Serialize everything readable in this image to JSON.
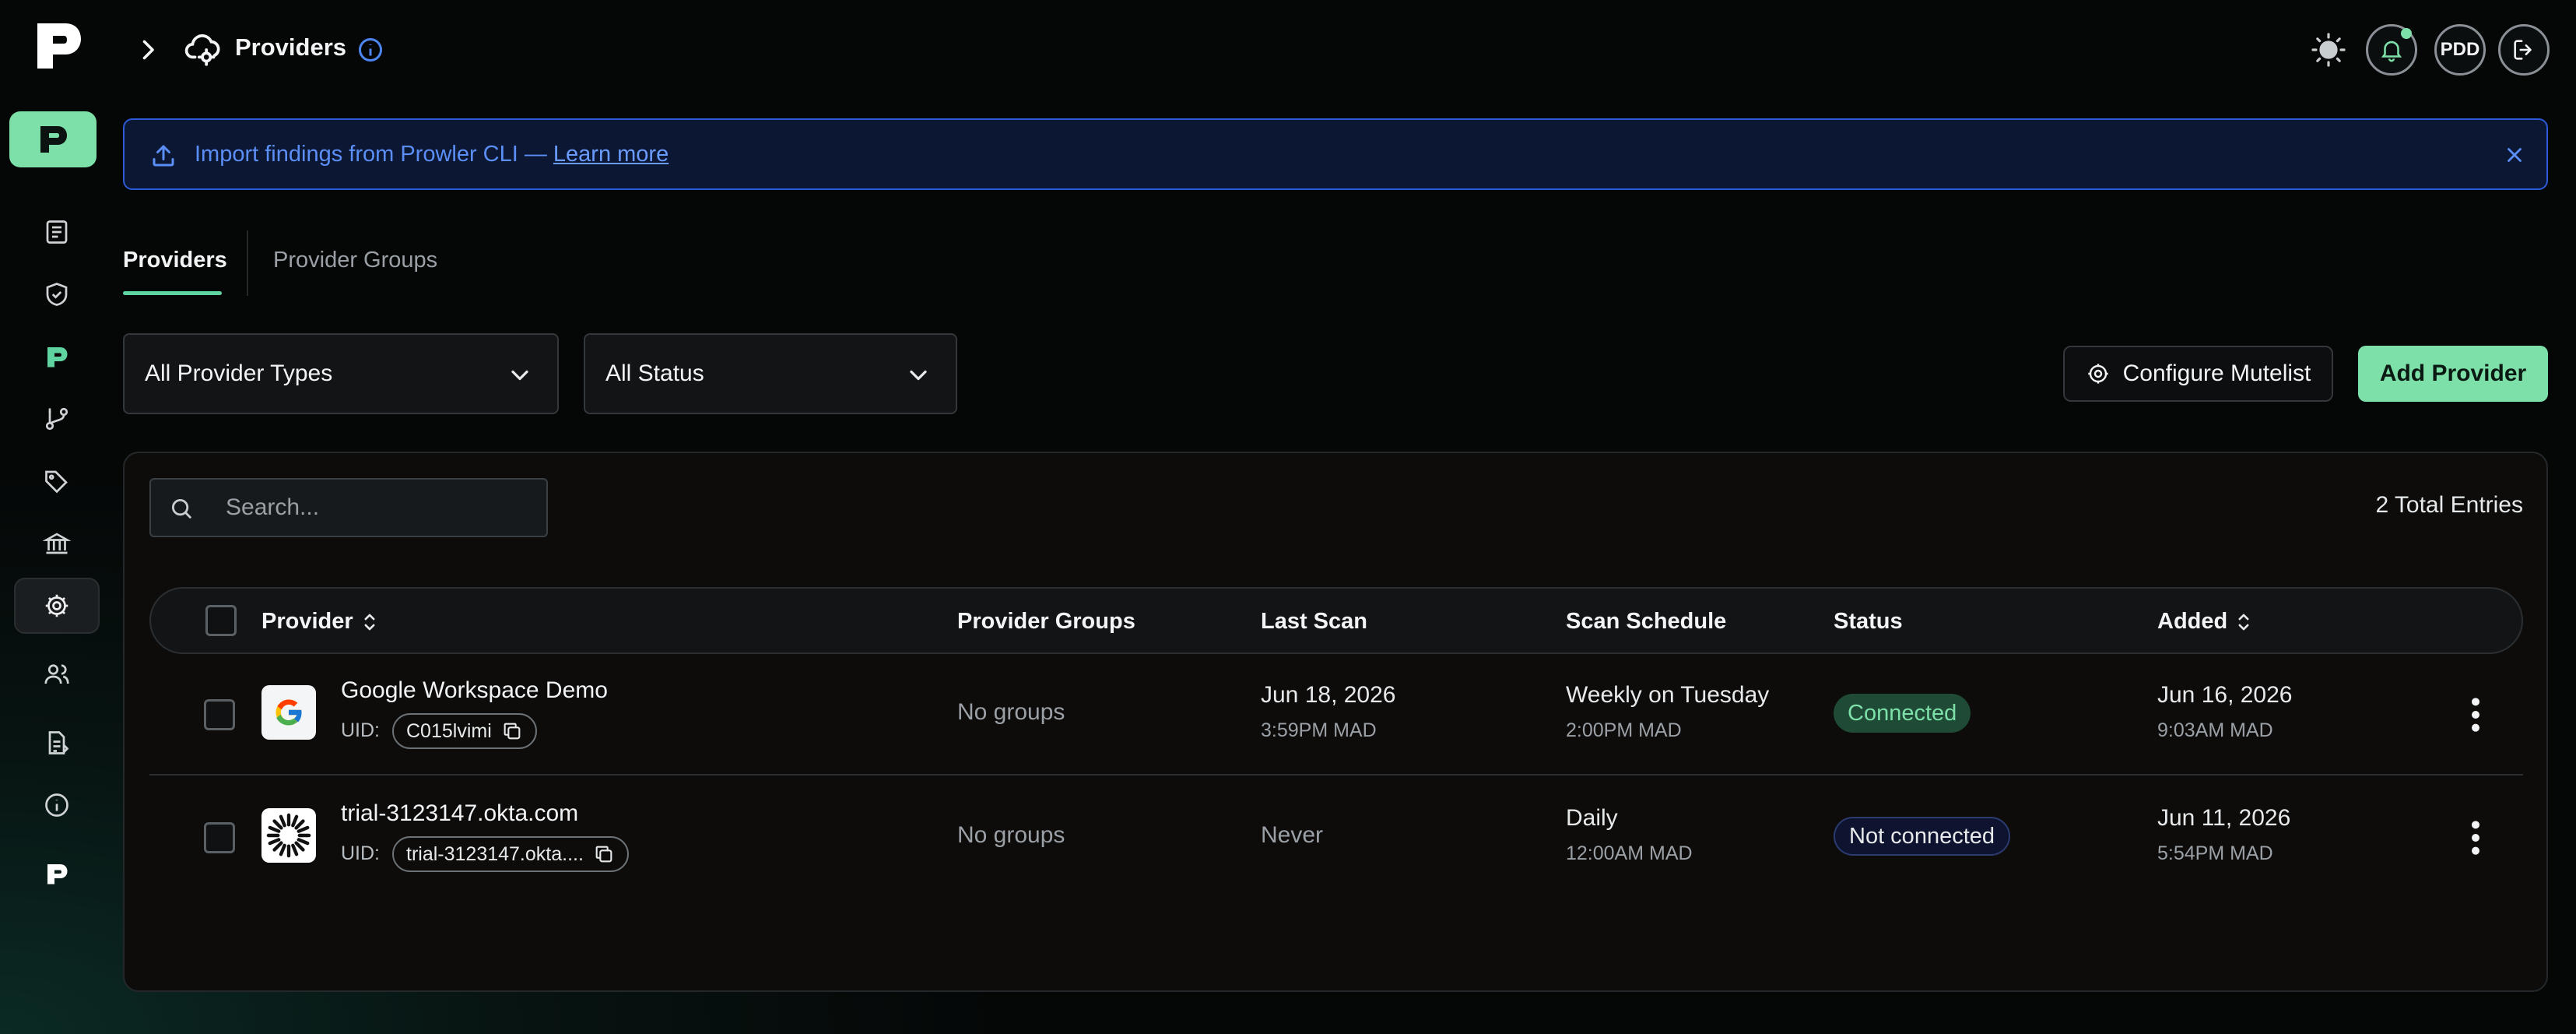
{
  "header": {
    "title": "Providers"
  },
  "topbar": {
    "avatar_initials": "PDD"
  },
  "banner": {
    "text": "Import findings from Prowler CLI — ",
    "link": "Learn more"
  },
  "tabs": [
    {
      "label": "Providers",
      "active": true
    },
    {
      "label": "Provider Groups",
      "active": false
    }
  ],
  "filters": {
    "provider_types": "All Provider Types",
    "status": "All Status"
  },
  "actions": {
    "mutelist": "Configure Mutelist",
    "add": "Add Provider"
  },
  "search": {
    "placeholder": "Search..."
  },
  "total": "2 Total Entries",
  "columns": {
    "provider": "Provider",
    "groups": "Provider Groups",
    "last_scan": "Last Scan",
    "schedule": "Scan Schedule",
    "status": "Status",
    "added": "Added"
  },
  "rows": [
    {
      "name": "Google Workspace Demo",
      "uid_label": "UID:",
      "uid": "C015lvimi",
      "groups": "No groups",
      "last_scan_date": "Jun 18, 2026",
      "last_scan_time": "3:59PM MAD",
      "schedule": "Weekly on Tuesday",
      "schedule_time": "2:00PM MAD",
      "status": "Connected",
      "added_date": "Jun 16, 2026",
      "added_time": "9:03AM MAD"
    },
    {
      "name": "trial-3123147.okta.com",
      "uid_label": "UID:",
      "uid": "trial-3123147.okta....",
      "groups": "No groups",
      "last_scan": "Never",
      "schedule": "Daily",
      "schedule_time": "12:00AM MAD",
      "status": "Not connected",
      "added_date": "Jun 11, 2026",
      "added_time": "5:54PM MAD"
    }
  ],
  "colors": {
    "accent": "#7ee0a9",
    "banner_border": "#2d5bd6",
    "banner_text": "#5b8ff7"
  }
}
